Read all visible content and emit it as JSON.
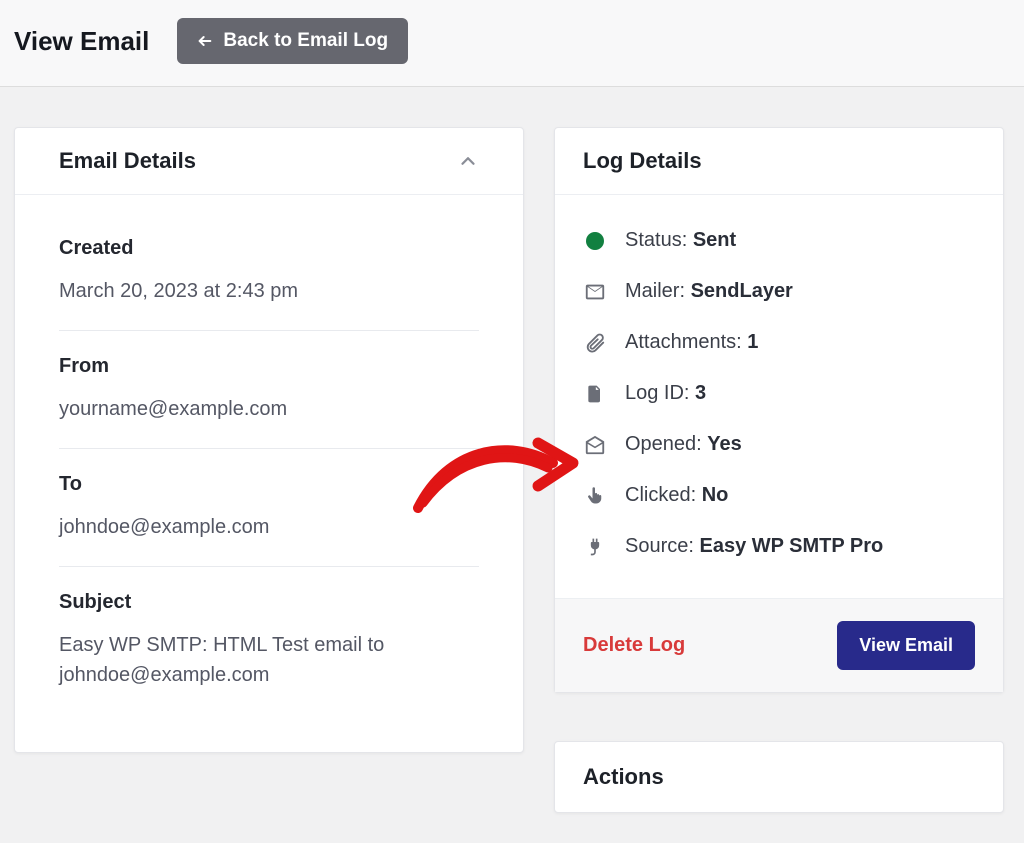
{
  "header": {
    "title": "View Email",
    "back_label": "Back to Email Log"
  },
  "email_details": {
    "title": "Email Details",
    "created_label": "Created",
    "created_value": "March 20, 2023 at 2:43 pm",
    "from_label": "From",
    "from_value": "yourname@example.com",
    "to_label": "To",
    "to_value": "johndoe@example.com",
    "subject_label": "Subject",
    "subject_value": "Easy WP SMTP: HTML Test email to johndoe@example.com"
  },
  "log_details": {
    "title": "Log Details",
    "status_label": "Status:",
    "status_value": "Sent",
    "mailer_label": "Mailer:",
    "mailer_value": "SendLayer",
    "attachments_label": "Attachments:",
    "attachments_value": "1",
    "logid_label": "Log ID:",
    "logid_value": "3",
    "opened_label": "Opened:",
    "opened_value": "Yes",
    "clicked_label": "Clicked:",
    "clicked_value": "No",
    "source_label": "Source:",
    "source_value": "Easy WP SMTP Pro",
    "delete_label": "Delete Log",
    "view_label": "View Email"
  },
  "actions": {
    "title": "Actions"
  }
}
